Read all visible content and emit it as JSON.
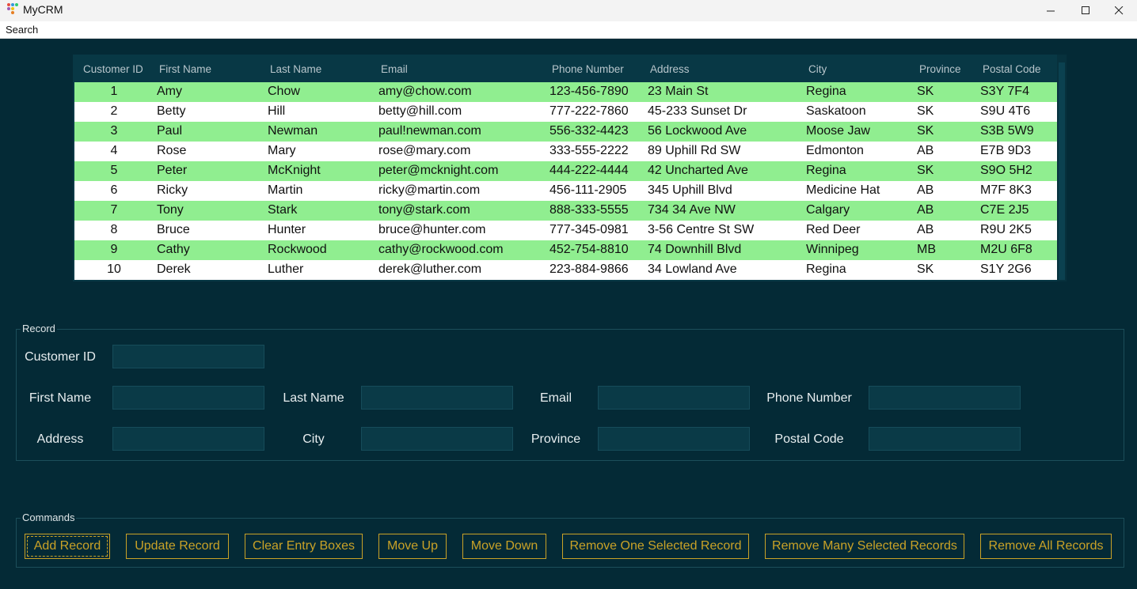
{
  "window": {
    "title": "MyCRM",
    "minimize_icon": "minimize-icon",
    "maximize_icon": "maximize-icon",
    "close_icon": "close-icon"
  },
  "menu": {
    "items": [
      "Search"
    ]
  },
  "table": {
    "columns": [
      "Customer ID",
      "First Name",
      "Last Name",
      "Email",
      "Phone Number",
      "Address",
      "City",
      "Province",
      "Postal Code"
    ],
    "rows": [
      [
        "1",
        "Amy",
        "Chow",
        "amy@chow.com",
        "123-456-7890",
        "23 Main St",
        "Regina",
        "SK",
        "S3Y 7F4"
      ],
      [
        "2",
        "Betty",
        "Hill",
        "betty@hill.com",
        "777-222-7860",
        "45-233 Sunset Dr",
        "Saskatoon",
        "SK",
        "S9U 4T6"
      ],
      [
        "3",
        "Paul",
        "Newman",
        "paul!newman.com",
        "556-332-4423",
        "56 Lockwood Ave",
        "Moose Jaw",
        "SK",
        "S3B 5W9"
      ],
      [
        "4",
        "Rose",
        "Mary",
        "rose@mary.com",
        "333-555-2222",
        "89 Uphill Rd SW",
        "Edmonton",
        "AB",
        "E7B 9D3"
      ],
      [
        "5",
        "Peter",
        "McKnight",
        "peter@mcknight.com",
        "444-222-4444",
        "42 Uncharted Ave",
        "Regina",
        "SK",
        "S9O 5H2"
      ],
      [
        "6",
        "Ricky",
        "Martin",
        "ricky@martin.com",
        "456-111-2905",
        "345 Uphill Blvd",
        "Medicine Hat",
        "AB",
        "M7F 8K3"
      ],
      [
        "7",
        "Tony",
        "Stark",
        "tony@stark.com",
        "888-333-5555",
        "734 34 Ave NW",
        "Calgary",
        "AB",
        "C7E 2J5"
      ],
      [
        "8",
        "Bruce",
        "Hunter",
        "bruce@hunter.com",
        "777-345-0981",
        "3-56 Centre St SW",
        "Red Deer",
        "AB",
        "R9U 2K5"
      ],
      [
        "9",
        "Cathy",
        "Rockwood",
        "cathy@rockwood.com",
        "452-754-8810",
        "74 Downhill Blvd",
        "Winnipeg",
        "MB",
        "M2U 6F8"
      ],
      [
        "10",
        "Derek",
        "Luther",
        "derek@luther.com",
        "223-884-9866",
        "34 Lowland Ave",
        "Regina",
        "SK",
        "S1Y 2G6"
      ]
    ],
    "row_colors": [
      "#90ee90",
      "#ffffff"
    ]
  },
  "record": {
    "title": "Record",
    "labels": {
      "customer_id": "Customer ID",
      "first_name": "First Name",
      "last_name": "Last Name",
      "email": "Email",
      "phone": "Phone Number",
      "address": "Address",
      "city": "City",
      "province": "Province",
      "postal_code": "Postal Code"
    },
    "values": {
      "customer_id": "",
      "first_name": "",
      "last_name": "",
      "email": "",
      "phone": "",
      "address": "",
      "city": "",
      "province": "",
      "postal_code": ""
    }
  },
  "commands": {
    "title": "Commands",
    "buttons": [
      "Add Record",
      "Update Record",
      "Clear Entry Boxes",
      "Move Up",
      "Move Down",
      "Remove One Selected Record",
      "Remove Many Selected Records",
      "Remove All Records"
    ]
  },
  "colors": {
    "background": "#042a36",
    "accent": "#c9a227",
    "row_highlight": "#90ee90"
  }
}
